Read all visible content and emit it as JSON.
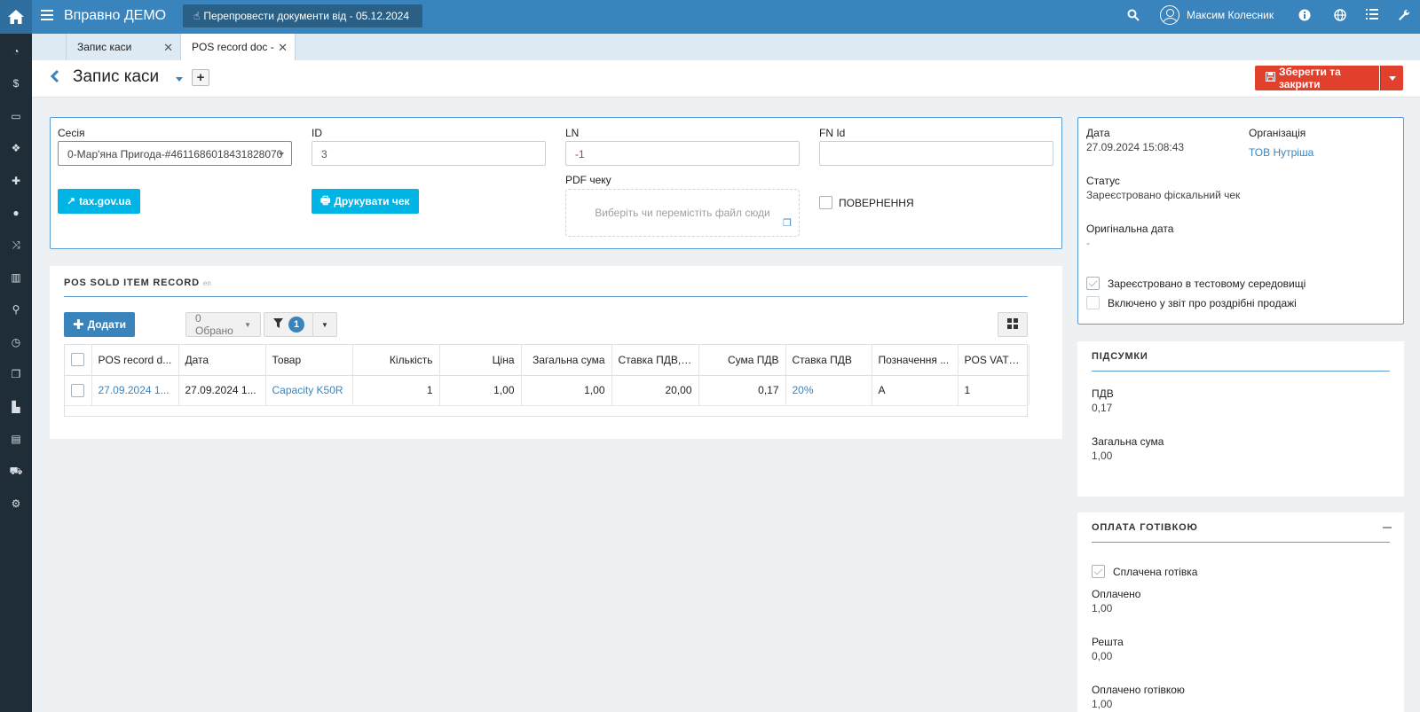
{
  "topbar": {
    "app_title": "Вправно ДЕМО",
    "repost_button": "Перепровести документи від - 05.12.2024",
    "user_name": "Максим Колесник"
  },
  "tabs": [
    {
      "label": "Запис каси"
    },
    {
      "label": "POS record doc -"
    }
  ],
  "header": {
    "title": "Запис каси",
    "save_button": "Зберегти та закрити"
  },
  "form": {
    "session_label": "Сесія",
    "session_value": "0-Мар'яна Пригода-#4611686018431828070",
    "id_label": "ID",
    "id_value": "3",
    "ln_label": "LN",
    "ln_value": "-1",
    "fn_label": "FN Id",
    "fn_value": "",
    "tax_button": "tax.gov.ua",
    "print_button": "Друкувати чек",
    "pdf_label": "PDF чеку",
    "pdf_placeholder": "Виберіть чи перемістіть файл сюди",
    "return_label": "ПОВЕРНЕННЯ"
  },
  "pos_section": {
    "title": "POS SOLD ITEM RECORD",
    "title_suffix": "en",
    "add_button": "Додати",
    "selected_button": "0 Обрано",
    "filter_count": "1",
    "columns": [
      "POS record d...",
      "Дата",
      "Товар",
      "Кількість",
      "Ціна",
      "Загальна сума",
      "Ставка ПДВ, %",
      "Сума ПДВ",
      "Ставка ПДВ",
      "Позначення ...",
      "POS VAT id"
    ],
    "column_suffix": "en",
    "rows": [
      {
        "record": "27.09.2024 1...",
        "date": "27.09.2024 1...",
        "product": "Capacity K50R",
        "qty": "1",
        "price": "1,00",
        "total": "1,00",
        "vat_pct": "20,00",
        "vat_sum": "0,17",
        "vat_rate": "20%",
        "mark": "A",
        "vat_id": "1"
      }
    ]
  },
  "info": {
    "date_label": "Дата",
    "date_value": "27.09.2024 15:08:43",
    "org_label": "Організація",
    "org_value": "ТОВ Нутріша",
    "status_label": "Статус",
    "status_value": "Зареєстровано фіскальний чек",
    "orig_date_label": "Оригінальна дата",
    "orig_date_value": "-",
    "test_env_label": "Зареєстровано в тестовому середовищі",
    "retail_report_label": "Включено у звіт про роздрібні продажі"
  },
  "totals": {
    "title": "ПІДСУМКИ",
    "vat_label": "ПДВ",
    "vat_value": "0,17",
    "total_label": "Загальна сума",
    "total_value": "1,00"
  },
  "cash": {
    "title": "ОПЛАТА ГОТІВКОЮ",
    "paid_cash_label": "Сплачена готівка",
    "paid_label": "Оплачено",
    "paid_value": "1,00",
    "change_label": "Решта",
    "change_value": "0,00",
    "paid_cash_amount_label": "Оплачено готівкою",
    "paid_cash_amount_value": "1,00"
  }
}
